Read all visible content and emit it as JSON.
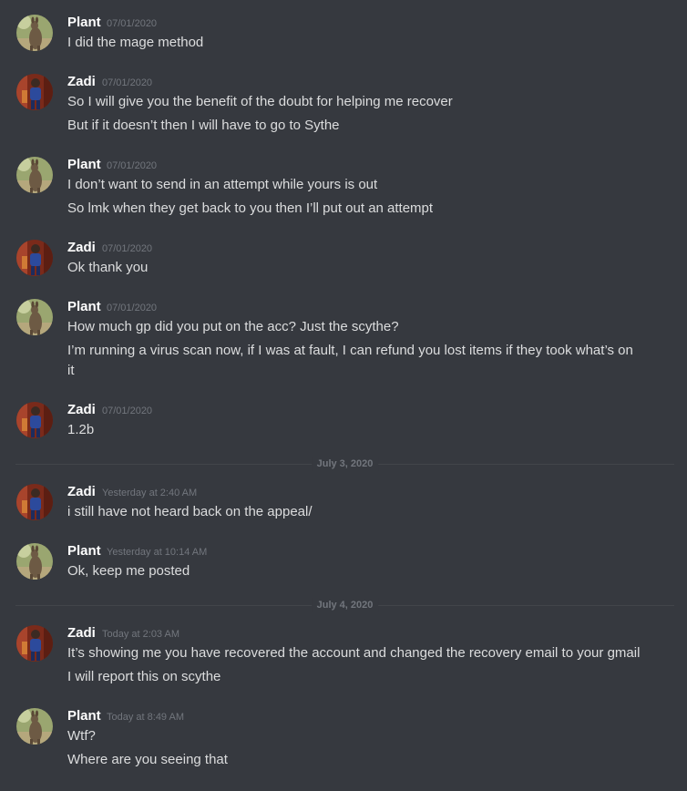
{
  "colors": {
    "background": "#36393f",
    "author": "#ffffff",
    "message_text": "#dcddde",
    "timestamp": "#72767d",
    "divider": "#42454a"
  },
  "users": {
    "plant": {
      "name": "Plant",
      "avatar": "kangaroo-avatar"
    },
    "zadi": {
      "name": "Zadi",
      "avatar": "person-avatar"
    }
  },
  "messages": [
    {
      "author": "Plant",
      "timestamp": "07/01/2020",
      "lines": [
        "I did the mage method"
      ]
    },
    {
      "author": "Zadi",
      "timestamp": "07/01/2020",
      "lines": [
        "So I will give you the benefit of the doubt for helping me recover",
        "But if it doesn’t then I will have to go to Sythe"
      ]
    },
    {
      "author": "Plant",
      "timestamp": "07/01/2020",
      "lines": [
        "I don’t want to send in an attempt while yours is out",
        "So lmk when they get back to you then I’ll put out an attempt"
      ]
    },
    {
      "author": "Zadi",
      "timestamp": "07/01/2020",
      "lines": [
        "Ok thank you"
      ]
    },
    {
      "author": "Plant",
      "timestamp": "07/01/2020",
      "lines": [
        "How much gp did you put on the acc? Just the scythe?",
        "I’m running a virus scan now, if I was at fault, I can refund you lost items if they took what’s on it"
      ]
    },
    {
      "author": "Zadi",
      "timestamp": "07/01/2020",
      "lines": [
        "1.2b"
      ]
    },
    {
      "author": "Zadi",
      "timestamp": "Yesterday at 2:40 AM",
      "lines": [
        "i still have not heard back on the appeal/"
      ]
    },
    {
      "author": "Plant",
      "timestamp": "Yesterday at 10:14 AM",
      "lines": [
        "Ok, keep me posted"
      ]
    },
    {
      "author": "Zadi",
      "timestamp": "Today at 2:03 AM",
      "lines": [
        "It’s showing me you have recovered the account and changed the recovery email to your gmail",
        "I will report this on scythe"
      ]
    },
    {
      "author": "Plant",
      "timestamp": "Today at 8:49 AM",
      "lines": [
        "Wtf?",
        "Where are you seeing that"
      ]
    }
  ],
  "dividers": [
    "July 3, 2020",
    "July 4, 2020"
  ]
}
